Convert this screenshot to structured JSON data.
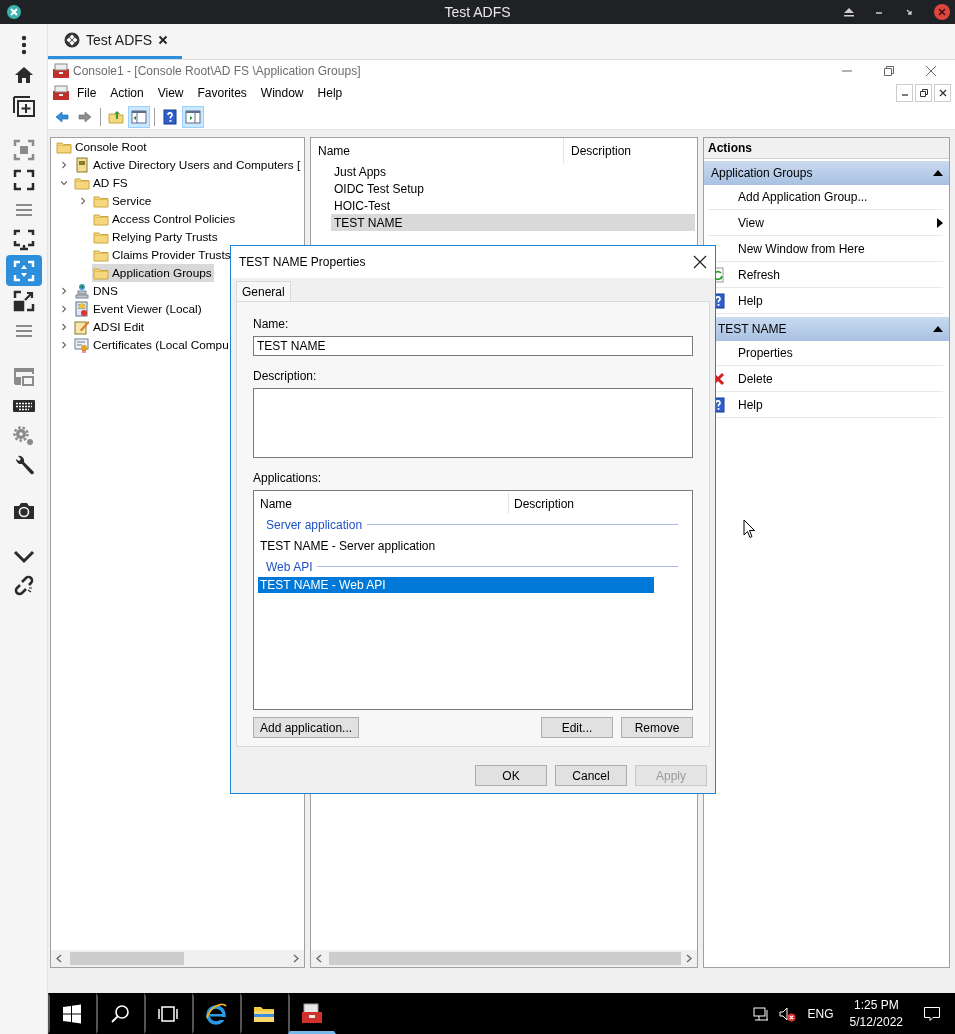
{
  "title_bar": {
    "title": "Test ADFS"
  },
  "sidebar": {
    "groups": [
      [
        {
          "kind": "dots",
          "selected": false
        },
        {
          "kind": "home",
          "selected": false
        },
        {
          "kind": "new-tab",
          "selected": false
        }
      ],
      [
        {
          "kind": "fit",
          "selected": false
        },
        {
          "kind": "fullscreen",
          "selected": false
        },
        {
          "kind": "lines",
          "selected": false
        },
        {
          "kind": "monitor",
          "selected": false
        },
        {
          "kind": "fit-arrows",
          "selected": true
        },
        {
          "kind": "expand",
          "selected": false
        },
        {
          "kind": "lines",
          "selected": false
        }
      ],
      [
        {
          "kind": "window",
          "selected": false
        },
        {
          "kind": "keyboard",
          "selected": false
        },
        {
          "kind": "gears",
          "selected": false
        },
        {
          "kind": "wrench",
          "selected": false
        }
      ],
      [
        {
          "kind": "camera",
          "selected": false
        }
      ],
      [
        {
          "kind": "chevron",
          "selected": false
        },
        {
          "kind": "link",
          "selected": false
        }
      ]
    ]
  },
  "tabs": [
    {
      "label": "Test ADFS",
      "selected": true
    }
  ],
  "console": {
    "title": "Console1 - [Console Root\\AD FS \\Application Groups]",
    "menu": [
      "File",
      "Action",
      "View",
      "Favorites",
      "Window",
      "Help"
    ],
    "toolbar": [
      [
        {
          "kind": "back",
          "on": false
        },
        {
          "kind": "forward",
          "on": false
        }
      ],
      [
        {
          "kind": "up",
          "on": false
        },
        {
          "kind": "tree",
          "on": true
        }
      ],
      [
        {
          "kind": "help",
          "on": false
        },
        {
          "kind": "actions",
          "on": true
        }
      ]
    ]
  },
  "tree": {
    "items": [
      {
        "label": "Console Root",
        "kind": "folder",
        "selected": false,
        "children": [
          {
            "label": "Active Directory Users and Computers [",
            "kind": "book",
            "expanded": false,
            "selected": false
          },
          {
            "label": "AD FS",
            "kind": "folder",
            "expanded": true,
            "selected": false,
            "children": [
              {
                "label": "Service",
                "kind": "folder",
                "expanded": false,
                "selected": false
              },
              {
                "label": "Access Control Policies",
                "kind": "folder",
                "selected": false
              },
              {
                "label": "Relying Party Trusts",
                "kind": "folder",
                "selected": false
              },
              {
                "label": "Claims Provider Trusts",
                "kind": "folder",
                "selected": false
              },
              {
                "label": "Application Groups",
                "kind": "folder",
                "selected": true
              }
            ]
          },
          {
            "label": "DNS",
            "kind": "dns",
            "expanded": false,
            "selected": false
          },
          {
            "label": "Event Viewer (Local)",
            "kind": "event",
            "expanded": false,
            "selected": false
          },
          {
            "label": "ADSI Edit",
            "kind": "adsi",
            "expanded": false,
            "selected": false
          },
          {
            "label": "Certificates (Local Compu",
            "kind": "cert",
            "expanded": false,
            "selected": false
          }
        ]
      }
    ]
  },
  "list": {
    "columns": [
      "Name",
      "Description"
    ],
    "rows": [
      {
        "name": "Just Apps",
        "selected": false
      },
      {
        "name": "OIDC Test Setup",
        "selected": false
      },
      {
        "name": "HOIC-Test",
        "selected": false
      },
      {
        "name": "TEST NAME",
        "selected": true
      }
    ]
  },
  "actions": {
    "title": "Actions",
    "sections": [
      {
        "title": "Application Groups",
        "items": [
          {
            "label": "Add Application Group...",
            "kind": "plain"
          },
          {
            "label": "View",
            "kind": "submenu"
          },
          {
            "label": "New Window from Here",
            "kind": "plain"
          },
          {
            "label": "Refresh",
            "kind": "refresh"
          },
          {
            "label": "Help",
            "kind": "help"
          }
        ]
      },
      {
        "title": "TEST NAME",
        "items": [
          {
            "label": "Properties",
            "kind": "plain"
          },
          {
            "label": "Delete",
            "kind": "delete"
          },
          {
            "label": "Help",
            "kind": "help"
          }
        ]
      }
    ]
  },
  "dialog": {
    "title": "TEST NAME Properties",
    "tabs": [
      {
        "label": "General",
        "selected": true
      }
    ],
    "name_label": "Name:",
    "name_value": "TEST NAME",
    "description_label": "Description:",
    "applications_label": "Applications:",
    "applications": {
      "columns": [
        "Name",
        "Description"
      ],
      "groups": [
        {
          "title": "Server application",
          "items": [
            {
              "name": "TEST NAME - Server application",
              "selected": false
            }
          ]
        },
        {
          "title": "Web API",
          "items": [
            {
              "name": "TEST NAME - Web API",
              "selected": true
            }
          ]
        }
      ]
    },
    "app_buttons": [
      {
        "label": "Add application...",
        "disabled": false
      },
      {
        "label": "Edit...",
        "disabled": false
      },
      {
        "label": "Remove",
        "disabled": false
      }
    ],
    "footer_buttons": [
      {
        "label": "OK",
        "disabled": false
      },
      {
        "label": "Cancel",
        "disabled": false
      },
      {
        "label": "Apply",
        "disabled": true
      }
    ]
  },
  "taskbar": {
    "apps": [
      {
        "kind": "browser",
        "selected": false
      },
      {
        "kind": "explorer",
        "selected": false
      },
      {
        "kind": "toolbox",
        "selected": true
      }
    ],
    "language": "ENG",
    "time": "1:25 PM",
    "date": "5/12/2022"
  }
}
